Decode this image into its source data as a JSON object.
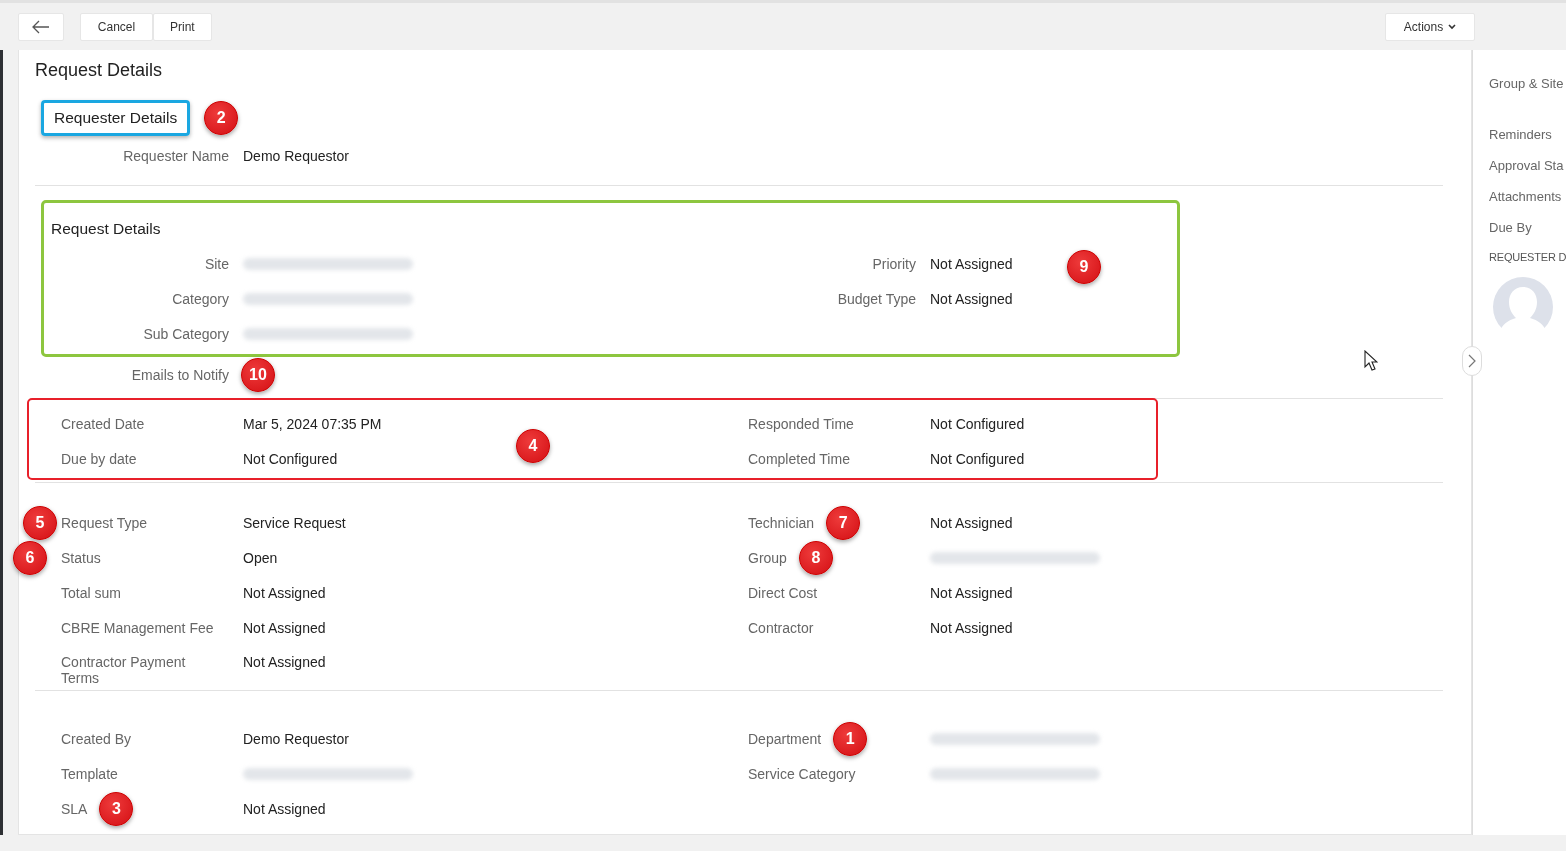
{
  "toolbar": {
    "buttons": [
      {
        "kind": "back"
      },
      {
        "kind": "text",
        "label": "Cancel"
      },
      {
        "kind": "text",
        "label": "Print"
      }
    ],
    "actions": {
      "label": "Actions"
    }
  },
  "page_title": "Request Details",
  "sections": [
    {
      "kind": "labelled",
      "heading": "Requester Details",
      "heading_outline": {
        "color": "#1aa7e1"
      },
      "marker": "2",
      "divider": true,
      "rows": [
        {
          "left": {
            "label": "Requester Name",
            "value": "Demo Requestor"
          }
        }
      ]
    },
    {
      "kind": "labelled",
      "heading": "Request Details",
      "outline": {
        "color": "#8dc63f"
      },
      "marker": "9",
      "divider": false,
      "rows": [
        {
          "left": {
            "label": "Site",
            "redacted": true
          },
          "right": {
            "label": "Priority",
            "value": "Not Assigned"
          }
        },
        {
          "left": {
            "label": "Category",
            "redacted": true
          },
          "right": {
            "label": "Budget Type",
            "value": "Not Assigned"
          }
        },
        {
          "left": {
            "label": "Sub Category",
            "redacted": true
          }
        }
      ]
    },
    {
      "kind": "labelled",
      "divider": true,
      "rows": [
        {
          "left": {
            "label": "Emails to Notify",
            "value_marker": "10"
          }
        }
      ]
    },
    {
      "kind": "plain",
      "outline": {
        "color": "#e8202a"
      },
      "marker": "4",
      "divider": true,
      "rows": [
        {
          "left": {
            "label": "Created Date",
            "value": "Mar 5, 2024 07:35 PM"
          },
          "right": {
            "label": "Responded Time",
            "value": "Not Configured"
          }
        },
        {
          "left": {
            "label": "Due by date",
            "value": "Not Configured"
          },
          "right": {
            "label": "Completed Time",
            "value": "Not Configured"
          }
        }
      ]
    },
    {
      "kind": "plain",
      "divider": true,
      "rows": [
        {
          "left": {
            "label": "Request Type",
            "value": "Service Request",
            "marker_before": "5"
          },
          "right": {
            "label": "Technician",
            "value": "Not Assigned",
            "marker": "7"
          }
        },
        {
          "left": {
            "label": "Status",
            "value": "Open",
            "marker_before": "6"
          },
          "right": {
            "label": "Group",
            "redacted": true,
            "marker": "8"
          }
        },
        {
          "left": {
            "label": "Total sum",
            "value": "Not Assigned"
          },
          "right": {
            "label": "Direct Cost",
            "value": "Not Assigned"
          }
        },
        {
          "left": {
            "label": "CBRE Management Fee",
            "value": "Not Assigned"
          },
          "right": {
            "label": "Contractor",
            "value": "Not Assigned"
          }
        },
        {
          "left": {
            "label": "Contractor Payment Terms",
            "value": "Not Assigned"
          }
        }
      ]
    },
    {
      "kind": "plain",
      "divider": false,
      "rows": [
        {
          "left": {
            "label": "Created By",
            "value": "Demo Requestor"
          },
          "right": {
            "label": "Department",
            "redacted": true,
            "marker": "1"
          }
        },
        {
          "left": {
            "label": "Template",
            "redacted": true
          },
          "right": {
            "label": "Service Category",
            "redacted": true
          }
        },
        {
          "left": {
            "label": "SLA",
            "value": "Not Assigned",
            "marker": "3"
          }
        }
      ]
    }
  ],
  "side_panel": {
    "items": [
      "Group & Site",
      "Reminders",
      "Approval Sta",
      "Attachments",
      "Due By"
    ],
    "heading": "REQUESTER D"
  }
}
